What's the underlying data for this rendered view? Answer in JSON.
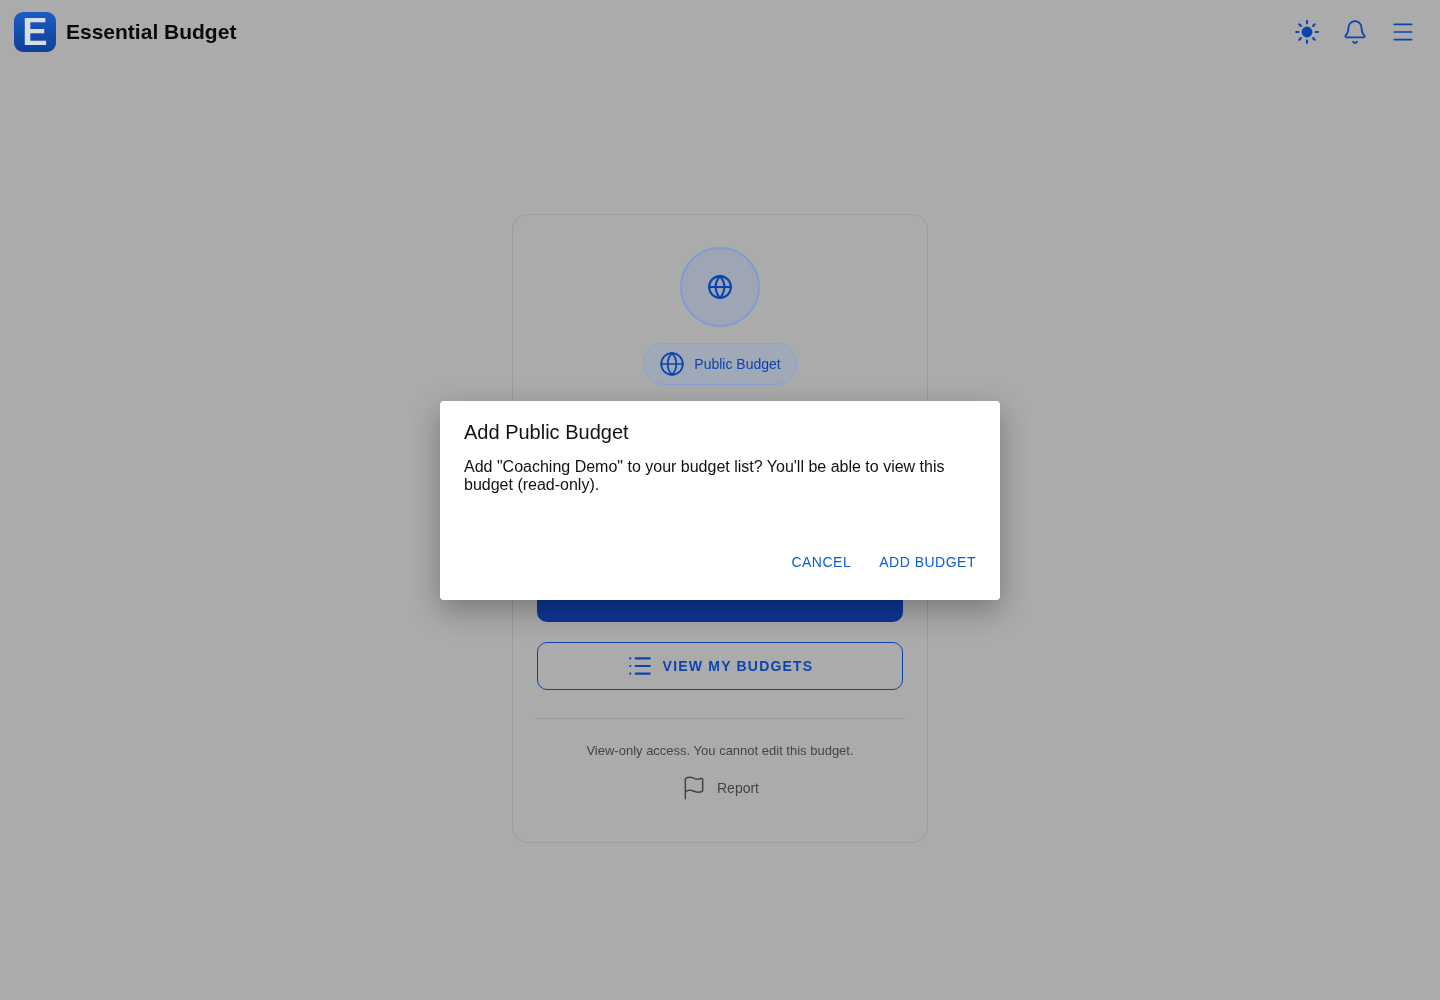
{
  "header": {
    "brand_letter": "E",
    "title": "Essential Budget"
  },
  "card": {
    "badge": "Public Budget",
    "view_button": "VIEW MY BUDGETS",
    "notice": "View-only access. You cannot edit this budget.",
    "report": "Report"
  },
  "dialog": {
    "title": "Add Public Budget",
    "message": "Add \"Coaching Demo\" to your budget list? You'll be able to view this budget (read-only).",
    "buttons": [
      "CANCEL",
      "ADD BUDGET"
    ]
  }
}
